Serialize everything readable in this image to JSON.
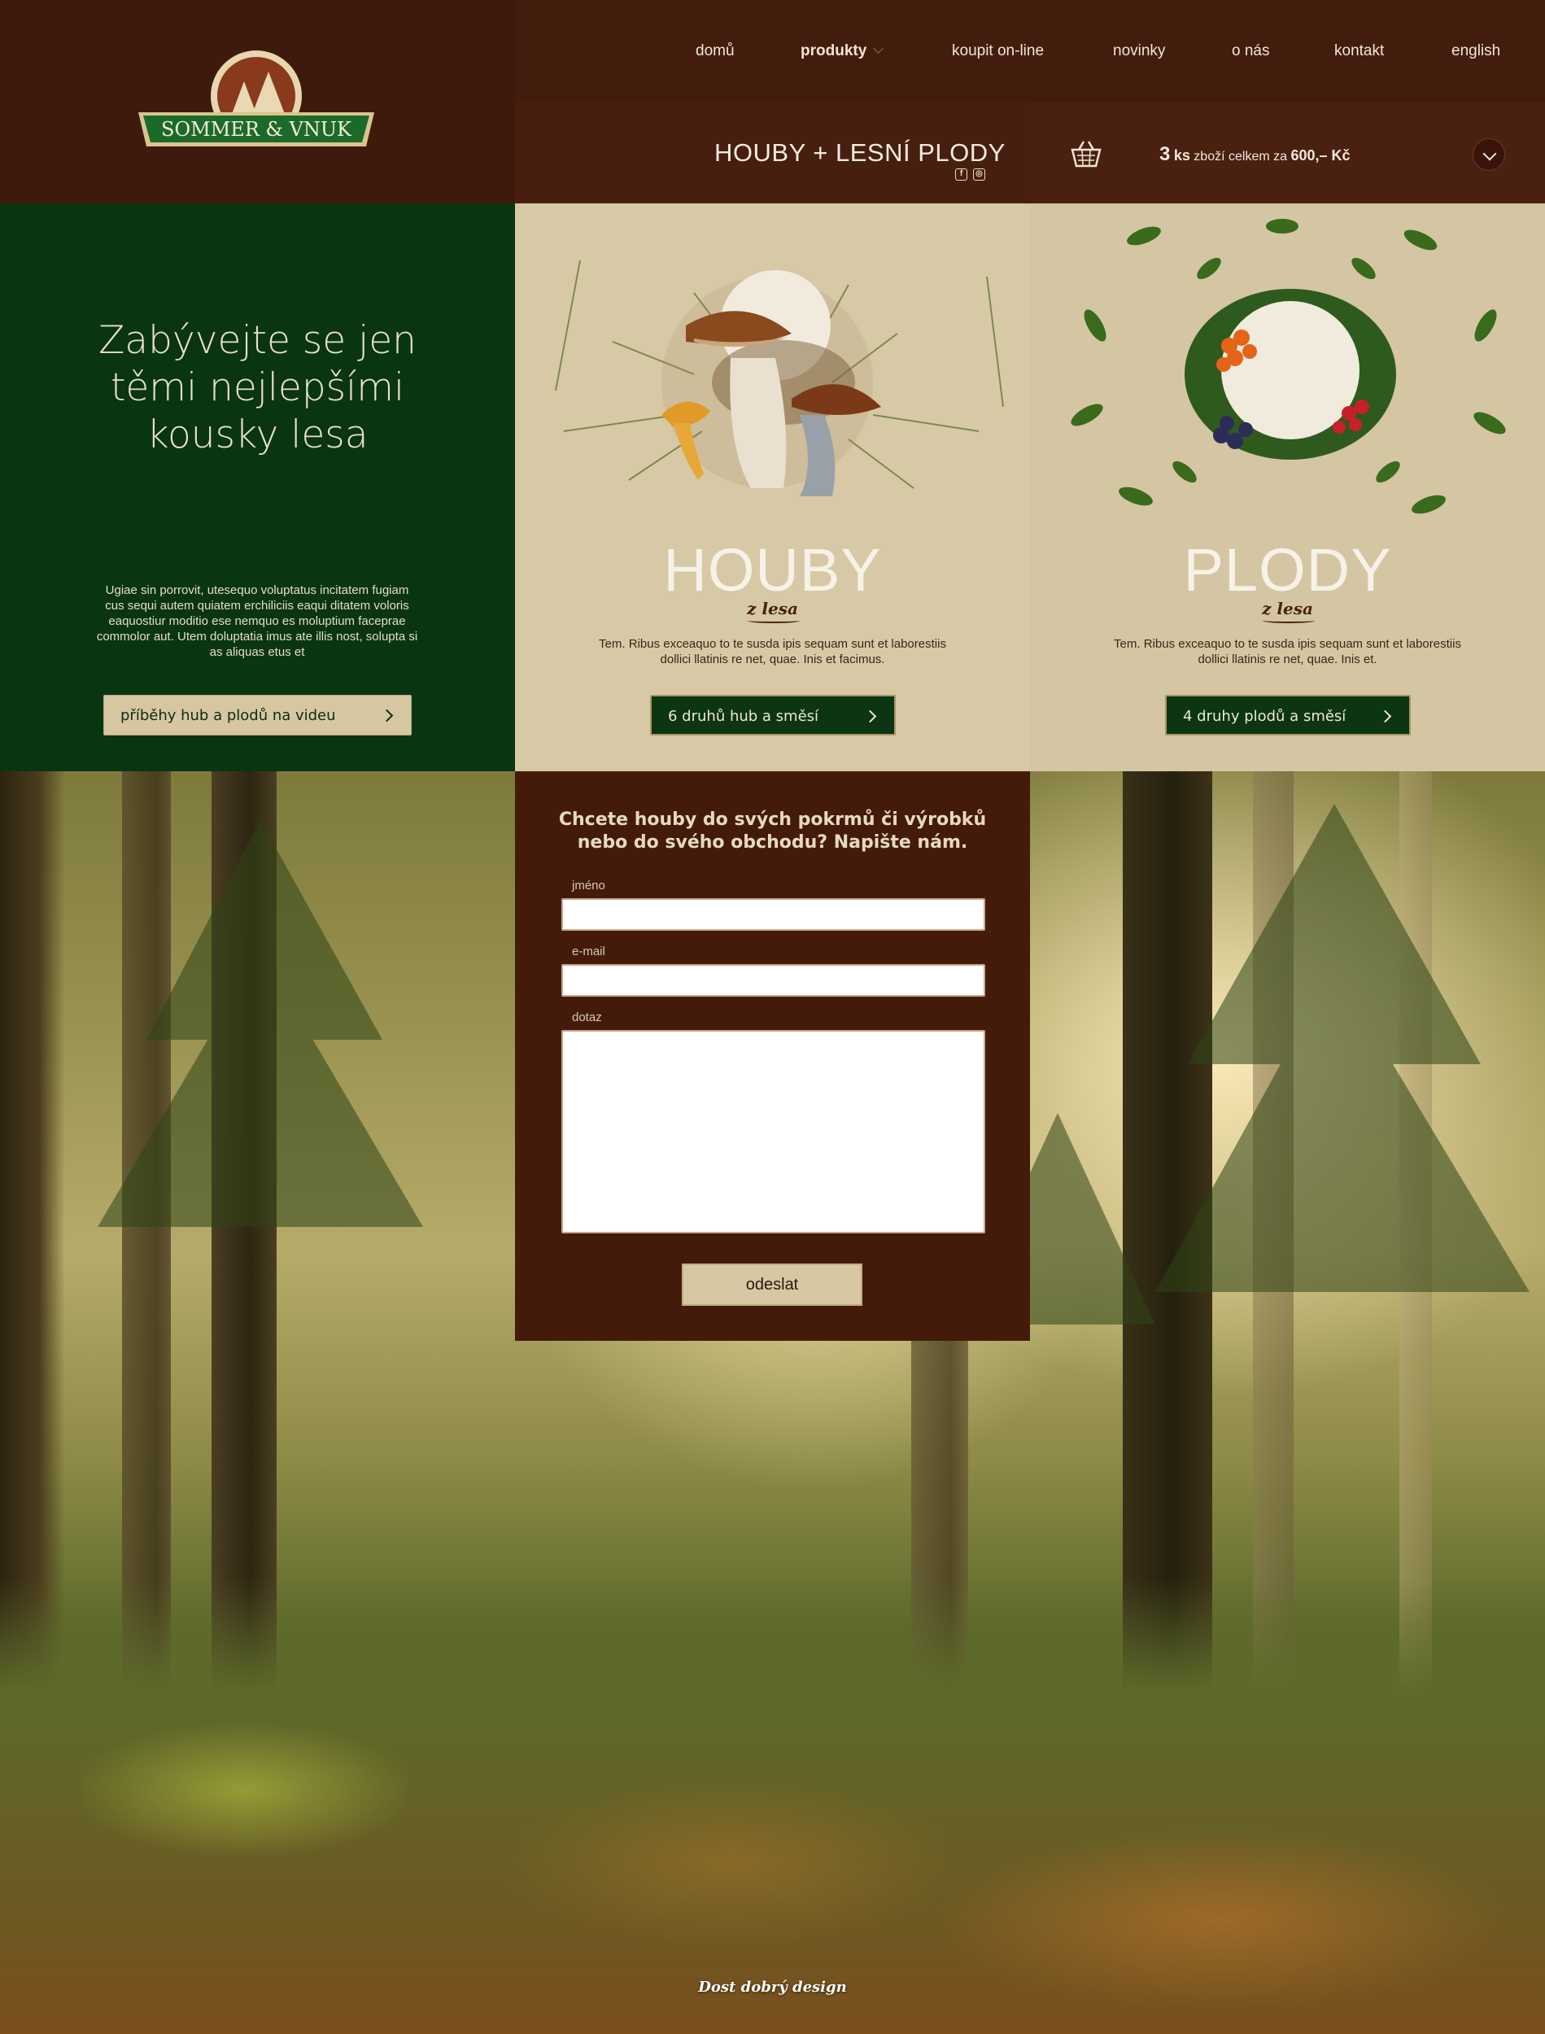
{
  "brand": {
    "name": "SOMMER & VNUK"
  },
  "nav": {
    "items": [
      {
        "label": "domů"
      },
      {
        "label": "produkty"
      },
      {
        "label": "koupit on-line"
      },
      {
        "label": "novinky"
      },
      {
        "label": "o nás"
      },
      {
        "label": "kontakt"
      },
      {
        "label": "english"
      }
    ],
    "active": "produkty"
  },
  "header": {
    "title": "HOUBY + LESNÍ PLODY",
    "social": [
      {
        "icon": "facebook-icon",
        "glyph": "f"
      },
      {
        "icon": "instagram-icon",
        "glyph": "◎"
      }
    ]
  },
  "cart": {
    "count": "3",
    "unit": "ks",
    "text": "zboží celkem za",
    "total": "600,– Kč"
  },
  "hero": {
    "title_lines": [
      "Zabývejte se jen",
      "těmi nejlepšími",
      "kousky lesa"
    ],
    "text": "Ugiae sin porrovit, utesequo voluptatus incitatem fugiam cus sequi autem quiatem erchiliciis eaqui ditatem voloris eaquostiur moditio ese nemquo es moluptium faceprae commolor aut. Utem doluptatia imus ate illis nost, solupta si as aliquas etus et",
    "button": "příběhy hub a plodů na videu"
  },
  "houby": {
    "word": "HOUBY",
    "sub": "z lesa",
    "text": "Tem. Ribus exceaquo to te susda ipis sequam sunt et laborestiis dollici llatinis re net, quae. Inis et facimus.",
    "button": "6 druhů hub a směsí"
  },
  "plody": {
    "word": "PLODY",
    "sub": "z lesa",
    "text": "Tem. Ribus exceaquo to te susda ipis sequam sunt et laborestiis dollici llatinis re net, quae. Inis et.",
    "button": "4 druhy plodů a směsí"
  },
  "contact": {
    "title_lines": [
      "Chcete houby do svých pokrmů či výrobků",
      "nebo do svého obchodu? Napište nám."
    ],
    "fields": [
      {
        "label": "jméno",
        "value": ""
      },
      {
        "label": "e-mail",
        "value": ""
      },
      {
        "label": "dotaz",
        "value": ""
      }
    ],
    "submit": "odeslat"
  },
  "footer": {
    "credit": "Dost dobrý design"
  },
  "colors": {
    "header_brown": "#421d0e",
    "form_brown": "#441b0b",
    "forest_green": "#0a3512",
    "beige": "#d7c9a6"
  }
}
